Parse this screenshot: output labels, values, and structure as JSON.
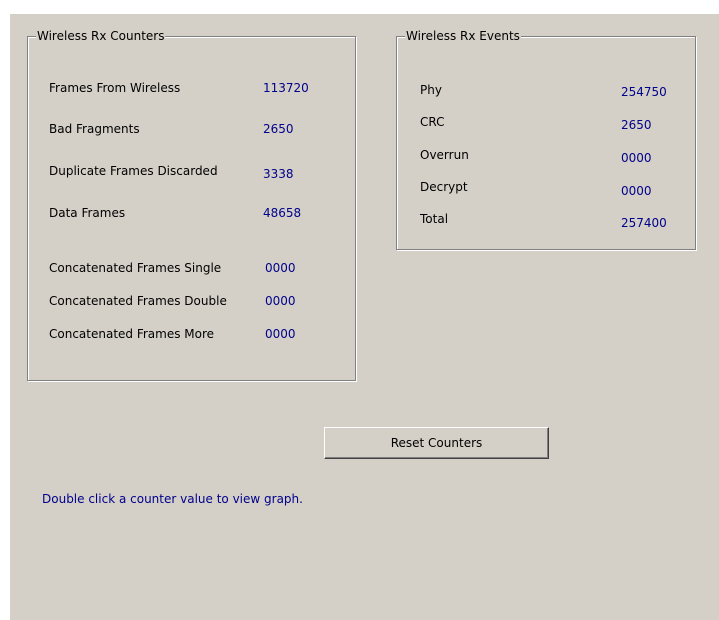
{
  "rx_counters": {
    "title": "Wireless Rx Counters",
    "items": [
      {
        "label": "Frames From Wireless",
        "value": "113720"
      },
      {
        "label": "Bad Fragments",
        "value": "2650"
      },
      {
        "label": "Duplicate Frames Discarded",
        "value": "3338"
      },
      {
        "label": "Data Frames",
        "value": "48658"
      },
      {
        "label": "Concatenated Frames Single",
        "value": "0000"
      },
      {
        "label": "Concatenated Frames Double",
        "value": "0000"
      },
      {
        "label": "Concatenated Frames More",
        "value": "0000"
      }
    ]
  },
  "rx_events": {
    "title": "Wireless Rx Events",
    "items": [
      {
        "label": "Phy",
        "value": "254750"
      },
      {
        "label": "CRC",
        "value": "2650"
      },
      {
        "label": "Overrun",
        "value": "0000"
      },
      {
        "label": "Decrypt",
        "value": "0000"
      },
      {
        "label": "Total",
        "value": "257400"
      }
    ]
  },
  "reset_button_label": "Reset Counters",
  "hint_text": "Double click a counter value to view graph.",
  "colors": {
    "dialog_background": "#d4d0c8",
    "value_text": "#00008b",
    "hint_text": "#00008b"
  }
}
